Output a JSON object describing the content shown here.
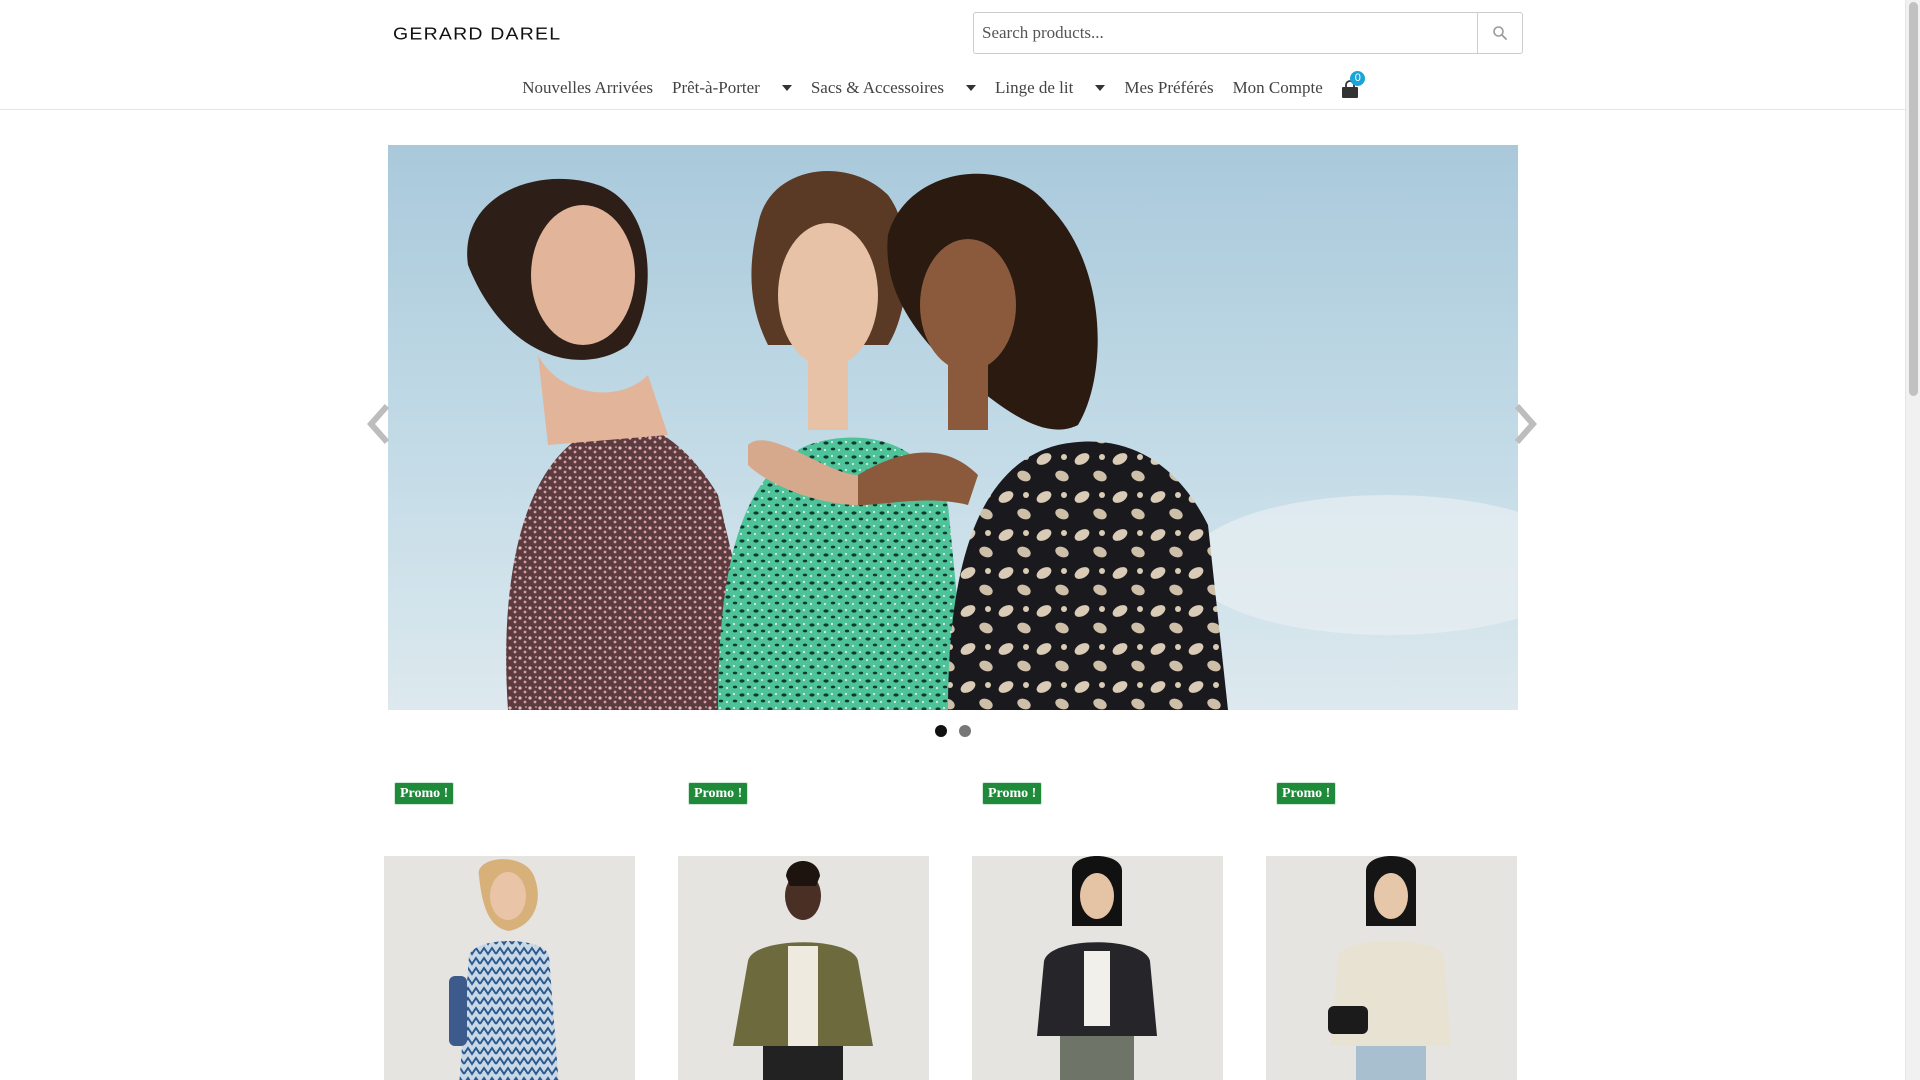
{
  "header": {
    "logo_text": "GERARD DAREL",
    "search": {
      "placeholder": "Search products..."
    },
    "nav": {
      "items": [
        {
          "label": "Nouvelles Arrivées",
          "dropdown": false
        },
        {
          "label": "Prêt-à-Porter",
          "dropdown": true
        },
        {
          "label": "Sacs & Accessoires",
          "dropdown": true
        },
        {
          "label": "Linge de lit",
          "dropdown": true
        },
        {
          "label": "Mes Préférés",
          "dropdown": false
        },
        {
          "label": "Mon Compte",
          "dropdown": false
        }
      ],
      "cart_count": "0"
    }
  },
  "hero": {
    "active_slide": 1,
    "slide_count": 2
  },
  "products": [
    {
      "badge": "Promo !",
      "image": "model in blue patterned dress"
    },
    {
      "badge": "Promo !",
      "image": "model in khaki bomber jacket"
    },
    {
      "badge": "Promo !",
      "image": "model in black leather jacket"
    },
    {
      "badge": "Promo !",
      "image": "model in cream tweed jacket"
    }
  ],
  "colors": {
    "promo_badge": "#1e8a3a",
    "cart_badge": "#1aa5d8",
    "text": "#444444"
  }
}
